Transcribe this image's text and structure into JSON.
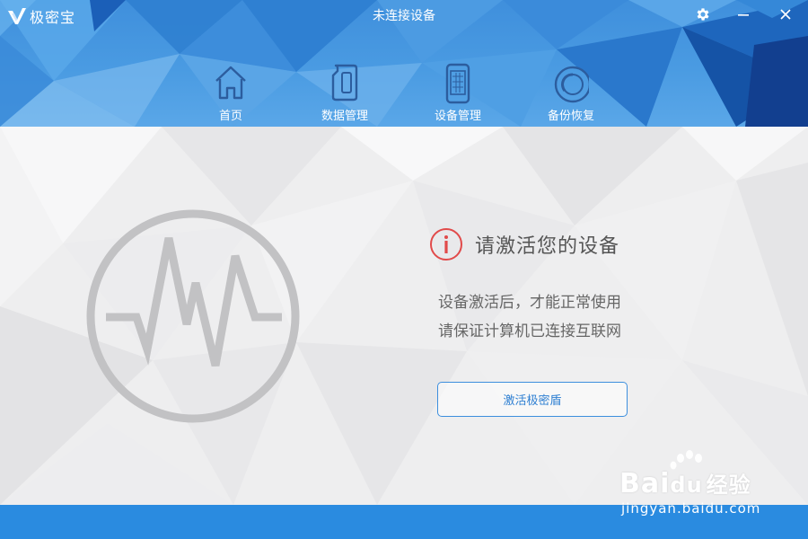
{
  "app": {
    "name": "极密宝",
    "window_title": "未连接设备"
  },
  "nav": [
    {
      "label": "首页",
      "icon": "home-icon",
      "active": true
    },
    {
      "label": "数据管理",
      "icon": "sd-card-icon",
      "active": false
    },
    {
      "label": "设备管理",
      "icon": "phone-device-icon",
      "active": false
    },
    {
      "label": "备份恢复",
      "icon": "backup-restore-icon",
      "active": false
    }
  ],
  "alert": {
    "title": "请激活您的设备",
    "icon": "info-icon"
  },
  "description": {
    "line1": "设备激活后，才能正常使用",
    "line2": "请保证计算机已连接互联网"
  },
  "activate_button": "激活极密盾",
  "watermark": {
    "brand": "Bai",
    "brand_suffix": "du",
    "brand_cn": "经验",
    "url": "jingyan.baidu.com"
  },
  "colors": {
    "accent": "#2a8be0",
    "header": "#4a9be2",
    "alert": "#e14a4a",
    "button_border": "#3d8fde"
  }
}
